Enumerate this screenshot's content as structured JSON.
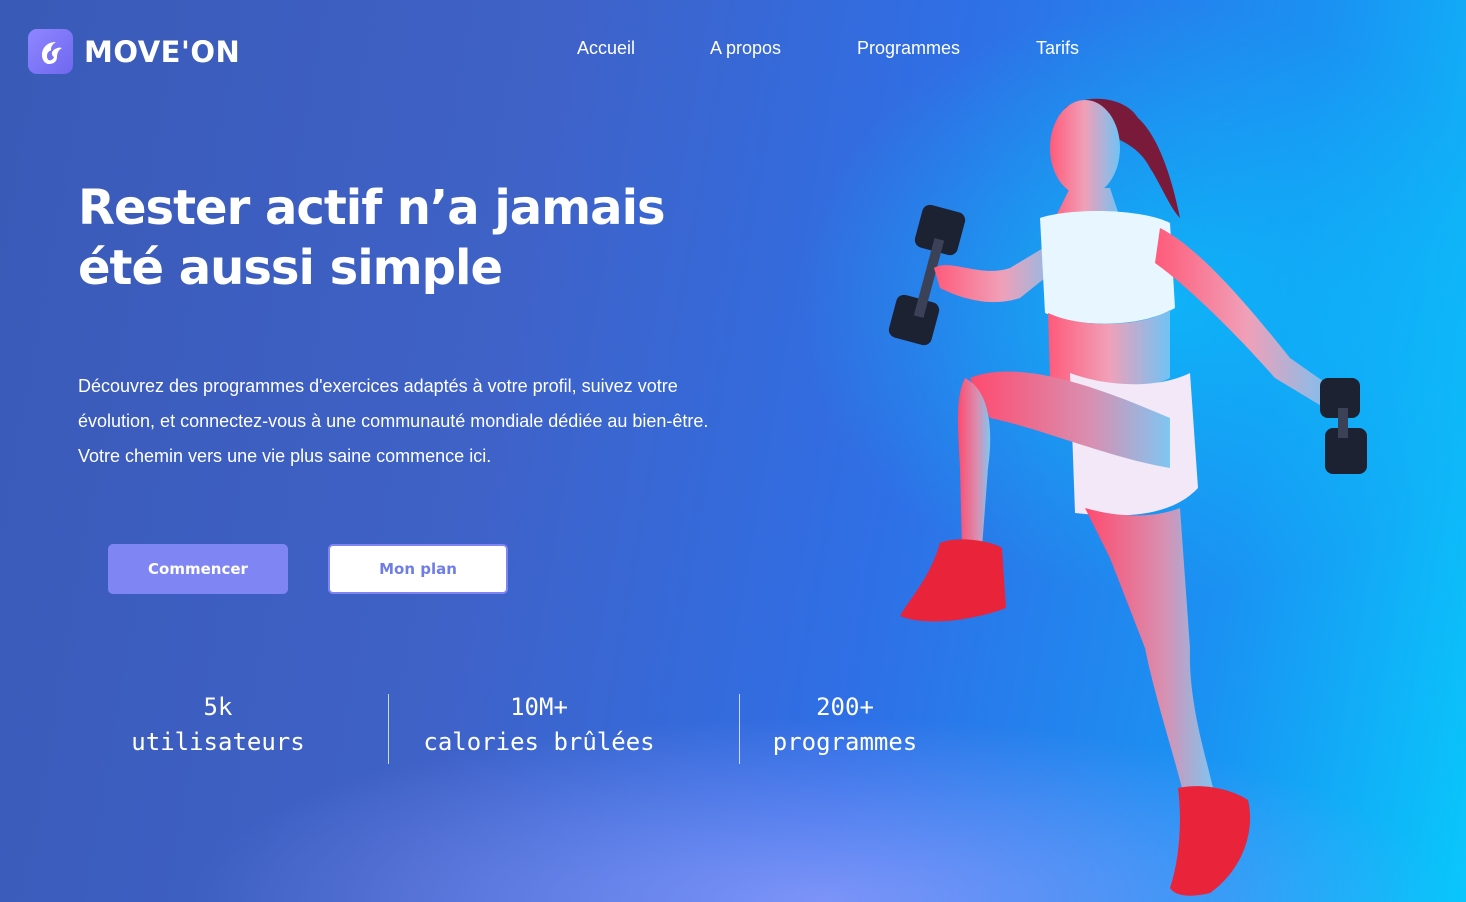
{
  "brand": {
    "name": "MOVE'ON",
    "logo_icon": "flame-swoosh-icon"
  },
  "nav": {
    "items": [
      {
        "label": "Accueil"
      },
      {
        "label": "A propos"
      },
      {
        "label": "Programmes"
      },
      {
        "label": "Tarifs"
      }
    ]
  },
  "hero": {
    "title_lines": [
      "Rester actif n’a jamais",
      "été aussi simple"
    ],
    "description_lines": [
      "Découvrez des programmes d'exercices adaptés à votre profil, suivez votre",
      "évolution, et connectez-vous à une communauté mondiale dédiée au bien-être.",
      "Votre chemin vers une vie plus saine commence ici."
    ],
    "primary_button": "Commencer",
    "secondary_button": "Mon plan"
  },
  "stats": [
    {
      "value": "5k",
      "label": "utilisateurs"
    },
    {
      "value": "10M+",
      "label": "calories brûlées"
    },
    {
      "value": "200+",
      "label": "programmes"
    }
  ],
  "colors": {
    "accent": "#7f86f4",
    "background_left": "#3a5ab7",
    "background_right": "#09c7fb",
    "text": "#ffffff"
  }
}
